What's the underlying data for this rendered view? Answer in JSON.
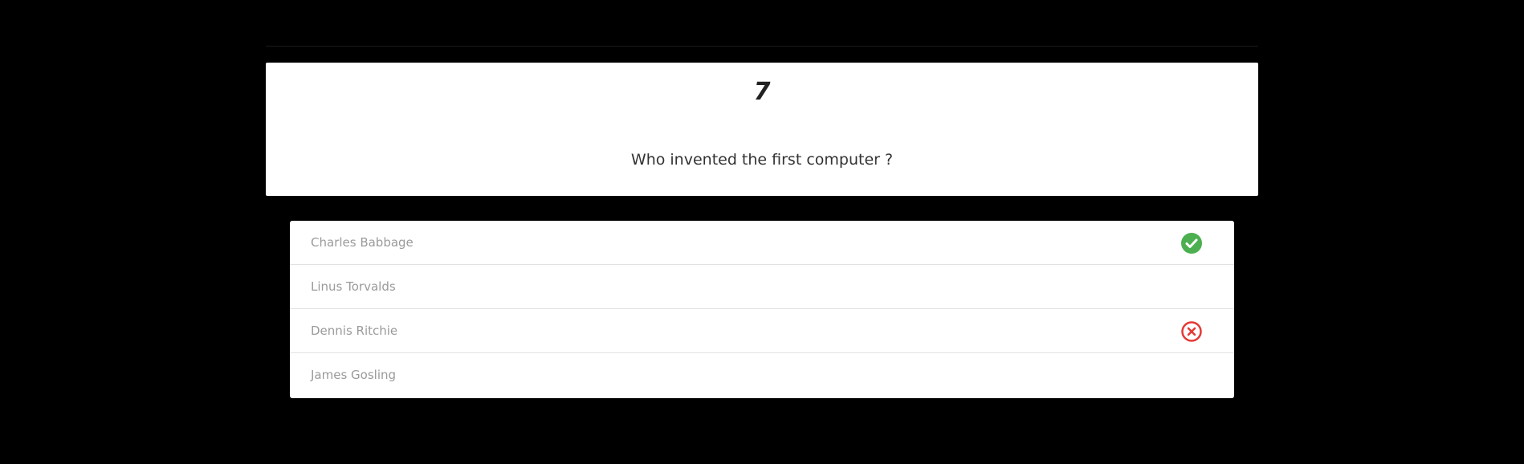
{
  "question": {
    "number": "7",
    "text": "Who invented the first computer ?"
  },
  "answers": [
    {
      "label": "Charles Babbage",
      "status": "correct",
      "icon": "check-circle-icon"
    },
    {
      "label": "Linus Torvalds",
      "status": "none"
    },
    {
      "label": "Dennis Ritchie",
      "status": "wrong",
      "icon": "x-circle-icon"
    },
    {
      "label": "James Gosling",
      "status": "none"
    }
  ],
  "colors": {
    "background": "#000000",
    "card": "#ffffff",
    "correct": "#4caf50",
    "wrong": "#e53935",
    "answer_text": "#9a9a9a"
  }
}
